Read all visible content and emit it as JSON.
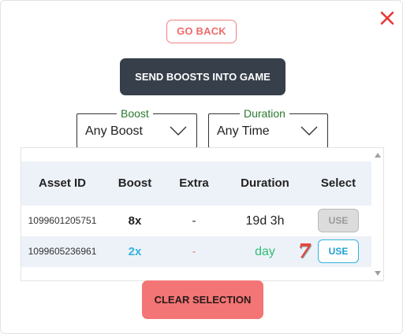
{
  "dialog": {
    "go_back_label": "GO BACK",
    "send_boosts_label": "SEND BOOSTS INTO GAME",
    "clear_selection_label": "CLEAR SELECTION",
    "close_icon": "close-x-icon",
    "accent_color": "#e53935"
  },
  "filters": {
    "boost": {
      "legend": "Boost",
      "value": "Any Boost"
    },
    "duration": {
      "legend": "Duration",
      "value": "Any Time"
    }
  },
  "table": {
    "headers": [
      "Asset ID",
      "Boost",
      "Extra",
      "Duration",
      "Select"
    ],
    "rows": [
      {
        "asset_id": "1099601205751",
        "boost": "8x",
        "boost_color": "#222222",
        "extra": "-",
        "extra_color": "#222222",
        "duration": "19d 3h",
        "duration_color": "#222222",
        "select_label": "USE",
        "select_enabled": false,
        "badge": ""
      },
      {
        "asset_id": "1099605236961",
        "boost": "2x",
        "boost_color": "#35b3dd",
        "extra": "-",
        "extra_color": "#f07f7f",
        "duration": "day",
        "duration_color": "#2fbf71",
        "select_label": "USE",
        "select_enabled": true,
        "badge": "7"
      }
    ]
  }
}
